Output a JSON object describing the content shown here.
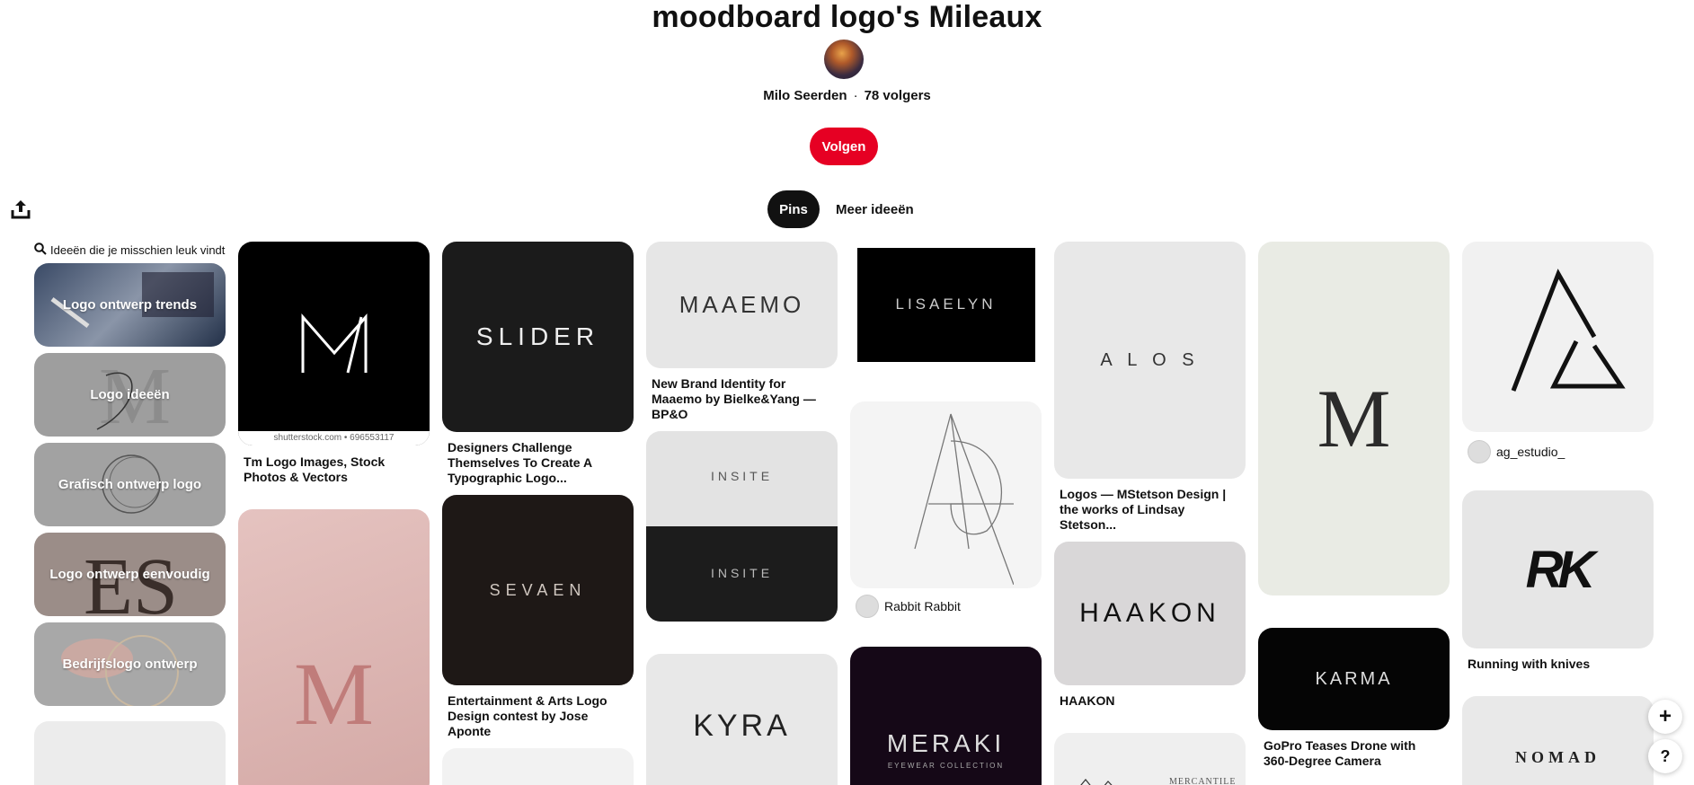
{
  "board": {
    "title": "moodboard logo's Mileaux",
    "owner": "Milo Seerden",
    "separator": "·",
    "followers": "78 volgers",
    "follow_label": "Volgen"
  },
  "tabs": [
    {
      "label": "Pins",
      "active": true
    },
    {
      "label": "Meer ideeën",
      "active": false
    }
  ],
  "sidebar": {
    "heading": "Ideeën die je misschien leuk vindt",
    "items": [
      {
        "label": "Logo ontwerp trends"
      },
      {
        "label": "Logo ideeën"
      },
      {
        "label": "Grafisch ontwerp logo"
      },
      {
        "label": "Logo ontwerp eenvoudig"
      },
      {
        "label": "Bedrijfslogo ontwerp"
      }
    ]
  },
  "pins": {
    "p1": {
      "logo_text": "M",
      "watermark": "shutterstock.com • 696553117",
      "caption": "Tm Logo Images, Stock Photos & Vectors"
    },
    "p2": {
      "logo_text": "M"
    },
    "p3": {
      "logo_text": "SLIDER",
      "caption": "Designers Challenge Themselves To Create A Typographic Logo..."
    },
    "p4": {
      "logo_text": "SEVAEN",
      "caption": "Entertainment & Arts Logo Design contest by Jose Aponte"
    },
    "p5": {
      "logo_text": "MAAEMO",
      "caption": "New Brand Identity for Maaemo by Bielke&Yang — BP&O"
    },
    "p6": {
      "logo_text_top": "INSITE",
      "logo_text_bottom": "INSITE"
    },
    "p7": {
      "logo_text": "KYRA"
    },
    "p8": {
      "logo_text": "LISAELYN"
    },
    "p9": {
      "logo_text": "AG",
      "user": "Rabbit Rabbit"
    },
    "p10": {
      "logo_text": "MERAKI",
      "sub": "EYEWEAR COLLECTION"
    },
    "p11": {
      "logo_text": "A L O S",
      "caption": "Logos — MStetson Design | the works of Lindsay Stetson..."
    },
    "p12": {
      "logo_text": "HAAKON",
      "caption": "HAAKON"
    },
    "p13": {
      "logo_text": "MERCANTILE"
    },
    "p14": {
      "logo_text": "M"
    },
    "p15": {
      "logo_text": "KARMA",
      "caption": "GoPro Teases Drone with 360-Degree Camera"
    },
    "p16": {
      "user": "ag_estudio_"
    },
    "p17": {
      "logo_text": "RK",
      "caption": "Running with knives"
    },
    "p18": {
      "logo_text": "NOMAD"
    }
  },
  "fab": {
    "add": "+",
    "help": "?"
  },
  "colors": {
    "accent": "#e60023",
    "tab_active": "#111111"
  },
  "icons": {
    "share": "share-icon",
    "search": "search-icon"
  }
}
